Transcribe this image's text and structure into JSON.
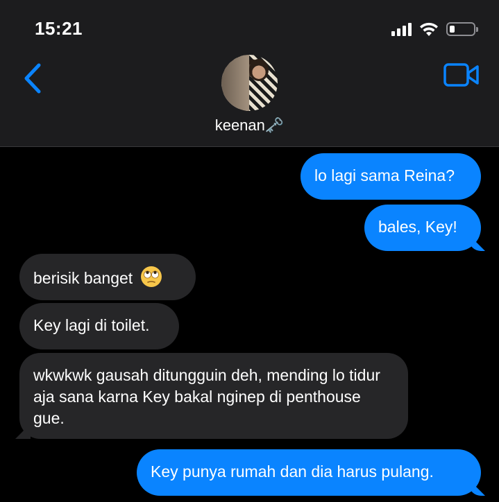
{
  "status_bar": {
    "time": "15:21",
    "icons": [
      "signal-icon",
      "wifi-icon",
      "battery-icon"
    ],
    "battery_level": 0.2
  },
  "header": {
    "contact_name": "keenan🗝️",
    "back_icon": "chevron-left-icon",
    "video_icon": "video-camera-icon"
  },
  "colors": {
    "outgoing_bubble": "#0a84ff",
    "incoming_bubble": "#262628",
    "header_bg": "#1c1c1e",
    "background": "#000000"
  },
  "messages": [
    {
      "direction": "out",
      "text": "lo lagi sama Reina?"
    },
    {
      "direction": "out",
      "text": "bales, Key!"
    },
    {
      "direction": "in",
      "text": "berisik banget",
      "emoji": "face-with-rolling-eyes"
    },
    {
      "direction": "in",
      "text": "Key lagi di toilet."
    },
    {
      "direction": "in",
      "text": "wkwkwk gausah ditungguin deh, mending lo tidur aja sana karna Key bakal nginep di penthouse gue."
    },
    {
      "direction": "out",
      "text": "Key punya rumah dan dia harus pulang."
    }
  ]
}
